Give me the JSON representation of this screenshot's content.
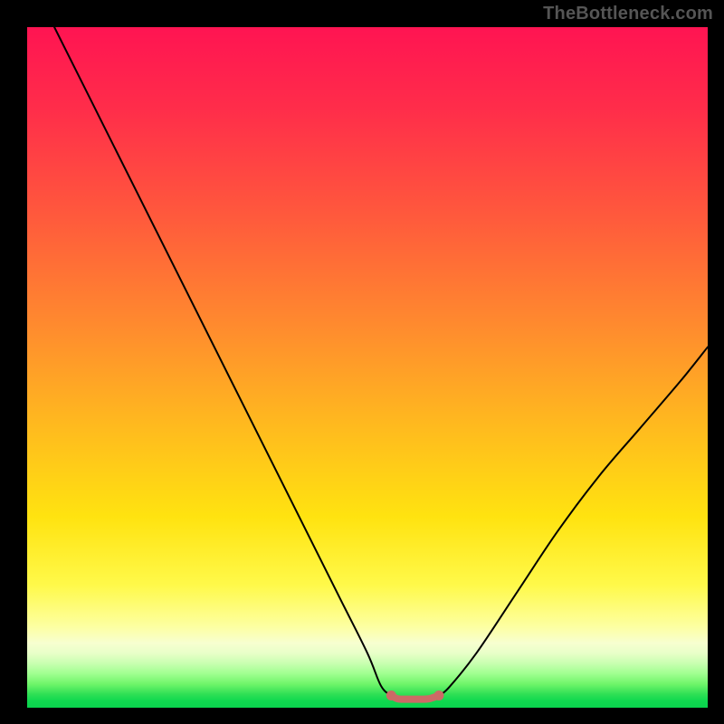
{
  "watermark": "TheBottleneck.com",
  "colors": {
    "frame": "#000000",
    "curve": "#000000",
    "bump": "#cc6a66",
    "watermark": "#555555"
  },
  "chart_data": {
    "type": "line",
    "title": "",
    "xlabel": "",
    "ylabel": "",
    "xlim": [
      0,
      100
    ],
    "ylim": [
      0,
      100
    ],
    "grid": false,
    "series": [
      {
        "name": "left-curve",
        "x": [
          4,
          10,
          16,
          22,
          28,
          34,
          40,
          46,
          50,
          52,
          53.5
        ],
        "values": [
          100,
          88,
          76,
          64,
          52,
          40,
          28,
          16,
          8,
          3.2,
          1.8
        ]
      },
      {
        "name": "right-curve",
        "x": [
          60.5,
          62,
          66,
          72,
          78,
          84,
          90,
          96,
          100
        ],
        "values": [
          1.8,
          3.0,
          8,
          17,
          26,
          34,
          41,
          48,
          53
        ]
      },
      {
        "name": "valley-bump",
        "x": [
          53.5,
          54.5,
          56,
          57.5,
          59,
          60.5
        ],
        "values": [
          1.8,
          1.3,
          1.25,
          1.25,
          1.3,
          1.8
        ]
      }
    ],
    "annotations": []
  }
}
